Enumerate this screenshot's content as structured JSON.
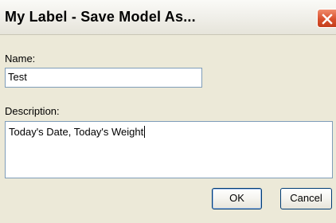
{
  "window": {
    "title": "My Label - Save Model As...",
    "close_icon": "close-icon"
  },
  "form": {
    "name_label": "Name:",
    "name_value": "Test",
    "description_label": "Description:",
    "description_value": "Today's Date, Today's Weight"
  },
  "buttons": {
    "ok_label": "OK",
    "cancel_label": "Cancel"
  },
  "colors": {
    "dialog_background": "#ece9d8",
    "close_button": "#d8502d",
    "field_border": "#7f9db9",
    "button_border": "#003c74"
  }
}
